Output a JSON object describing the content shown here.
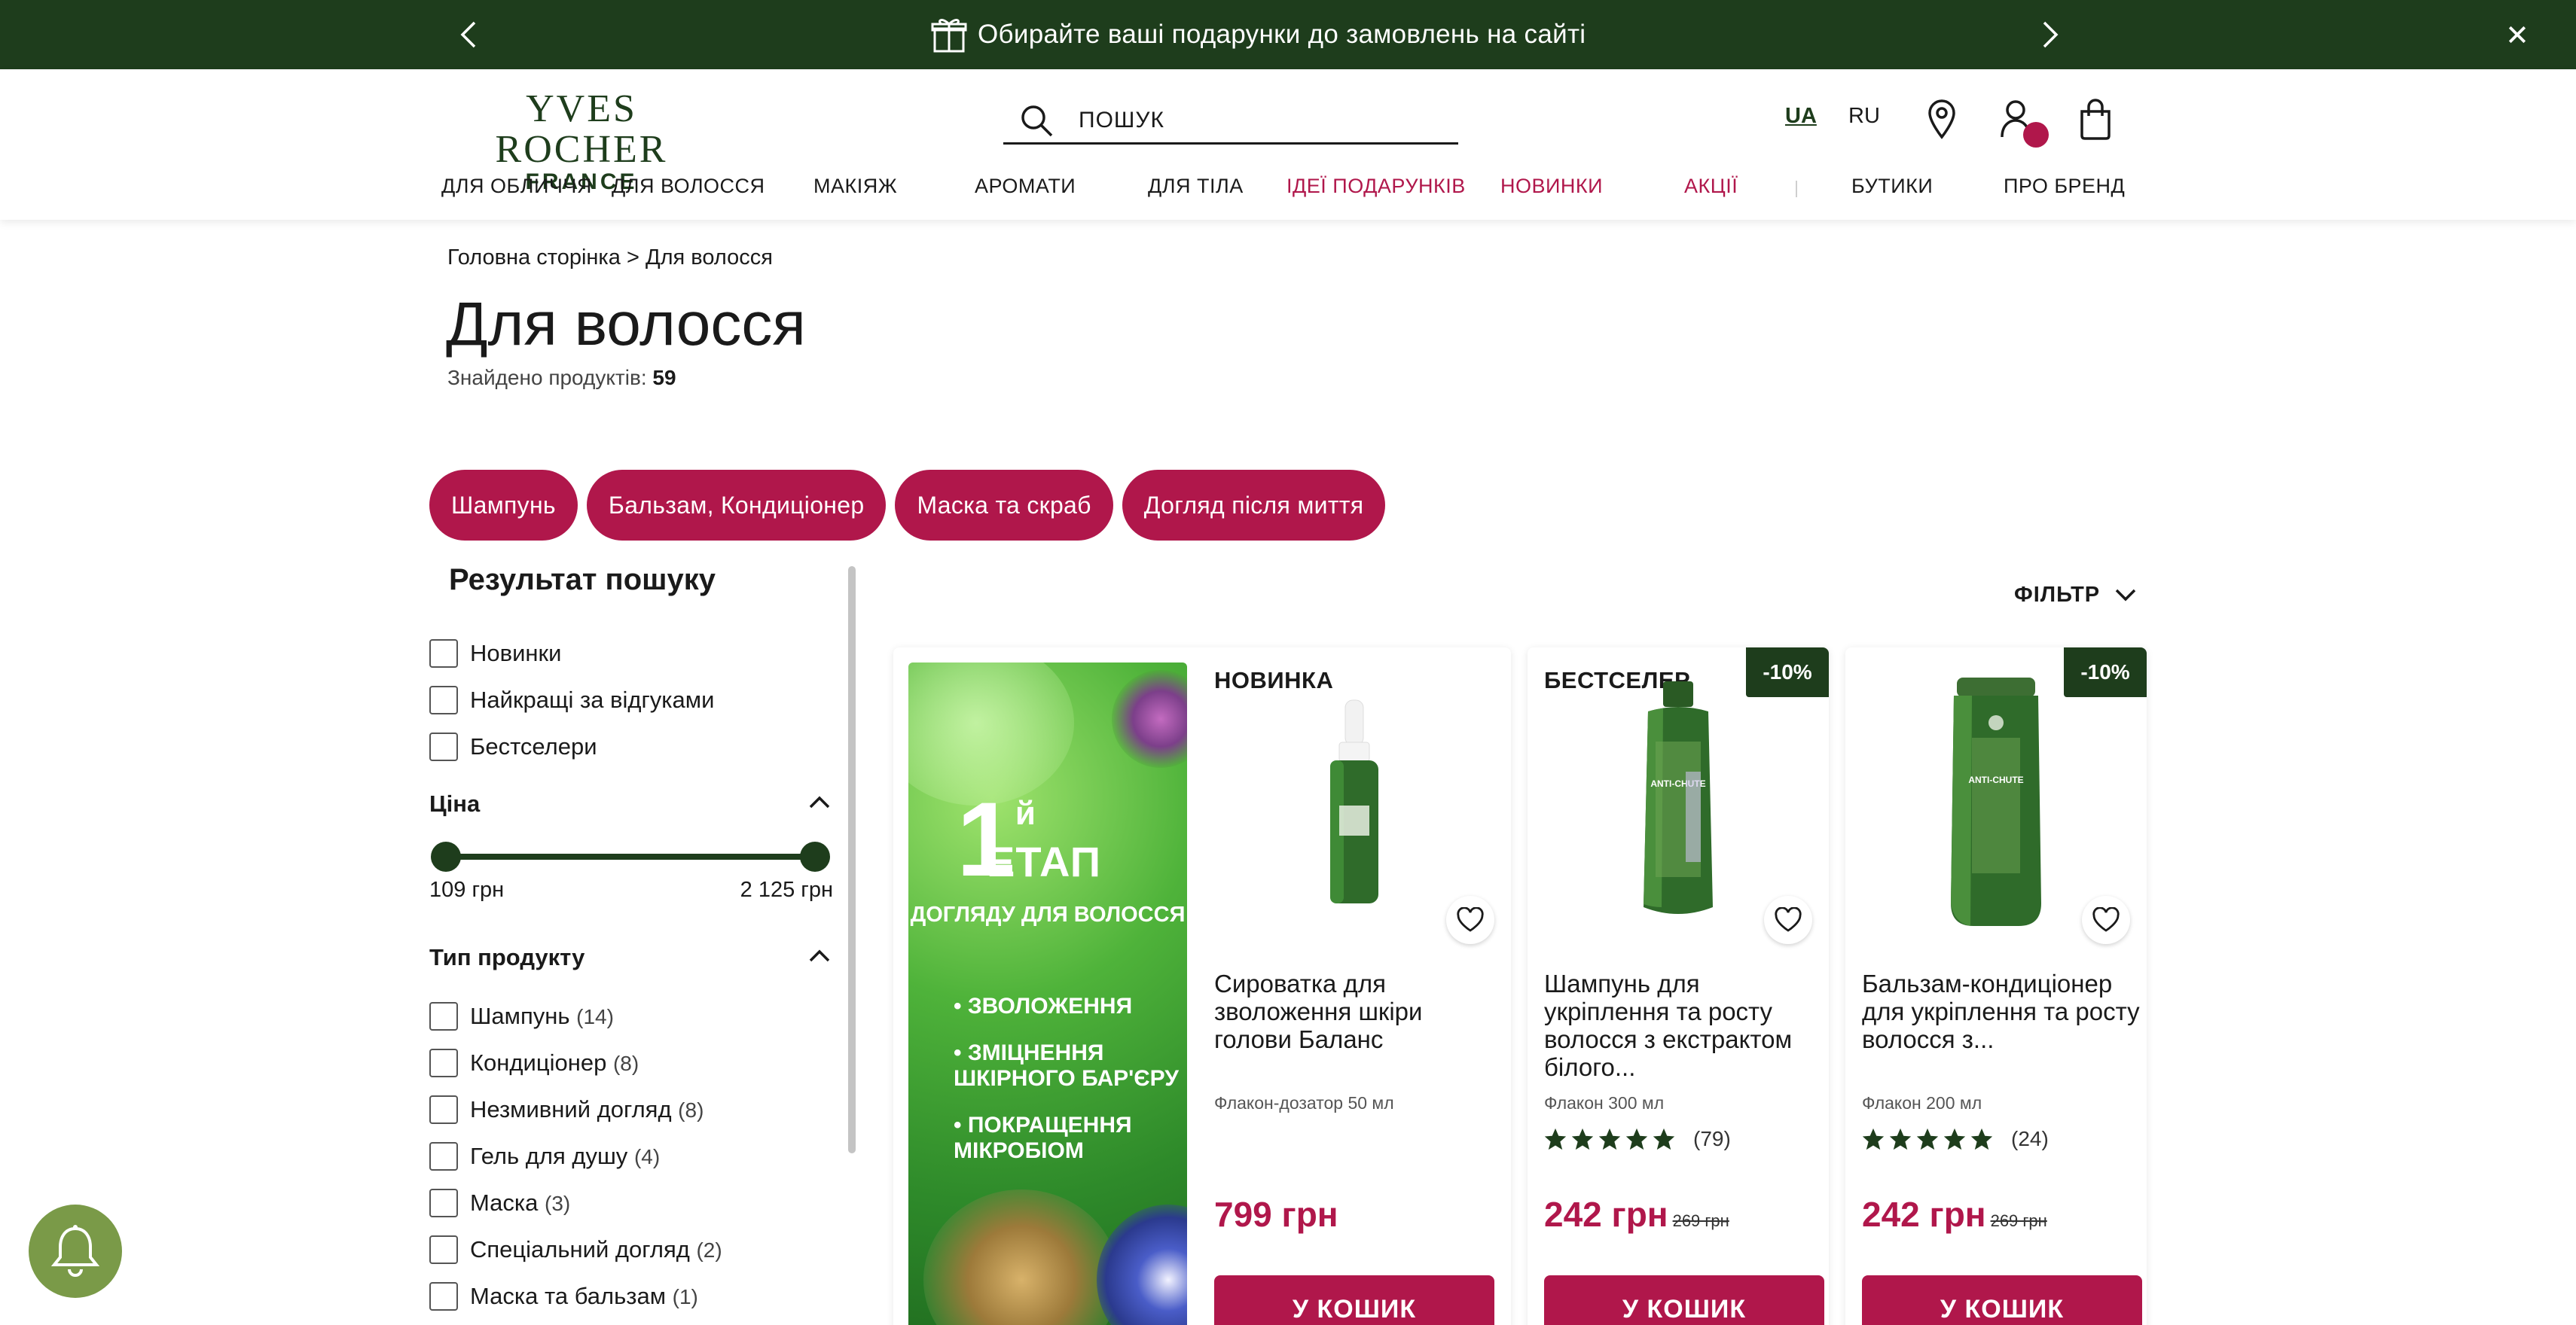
{
  "promo": {
    "message": "Обирайте ваші подарунки до замовлень на сайті"
  },
  "header": {
    "logo_line1": "YVES ROCHER",
    "logo_line2": "FRANCE",
    "search_placeholder": "ПОШУК",
    "lang_ua": "UA",
    "lang_ru": "RU"
  },
  "nav": [
    "ДЛЯ ОБЛИЧЧЯ",
    "ДЛЯ ВОЛОССЯ",
    "МАКІЯЖ",
    "АРОМАТИ",
    "ДЛЯ ТІЛА",
    "ІДЕЇ ПОДАРУНКІВ",
    "НОВИНКИ",
    "АКЦІЇ",
    "БУТИКИ",
    "ПРО БРЕНД"
  ],
  "breadcrumb": {
    "home": "Головна сторінка",
    "sep": ">",
    "current": "Для волосся"
  },
  "page": {
    "title": "Для волосся",
    "found_label": "Знайдено продуктів:",
    "found_count": "59"
  },
  "chips": [
    "Шампунь",
    "Бальзам, Кондиціонер",
    "Маска та скраб",
    "Догляд після миття"
  ],
  "sidebar": {
    "title": "Результат пошуку",
    "quick": [
      "Новинки",
      "Найкращі за відгуками",
      "Бестселери"
    ],
    "price_title": "Ціна",
    "price_min": "109 грн",
    "price_max": "2 125 грн",
    "type_title": "Тип продукту",
    "types": [
      {
        "label": "Шампунь",
        "count": "(14)"
      },
      {
        "label": "Кондиціонер",
        "count": "(8)"
      },
      {
        "label": "Незмивний догляд",
        "count": "(8)"
      },
      {
        "label": "Гель для душу",
        "count": "(4)"
      },
      {
        "label": "Маска",
        "count": "(3)"
      },
      {
        "label": "Спеціальний догляд",
        "count": "(2)"
      },
      {
        "label": "Маска та бальзам",
        "count": "(1)"
      }
    ]
  },
  "filter_label": "ФІЛЬТР",
  "banner": {
    "num": "1",
    "sup": "й",
    "word": "ЕТАП",
    "sub": "ДОГЛЯДУ ДЛЯ ВОЛОССЯ",
    "bullets": [
      "• ЗВОЛОЖЕННЯ",
      "• ЗМІЦНЕННЯ ШКІРНОГО БАР'ЄРУ",
      "• ПОКРАЩЕННЯ МІКРОБІОМ"
    ]
  },
  "products": [
    {
      "tag": "НОВИНКА",
      "name": "Сироватка для зволоження шкіри голови Баланс",
      "volume": "Флакон-дозатор 50 мл",
      "price": "799 грн",
      "cart": "У КОШИК"
    },
    {
      "tag": "БЕСТСЕЛЕР",
      "discount": "-10%",
      "name": "Шампунь для укріплення та росту волосся з екстрактом білого...",
      "volume": "Флакон 300 мл",
      "rating": 5,
      "reviews": "(79)",
      "price": "242 грн",
      "old_price": "269 грн",
      "cart": "У КОШИК"
    },
    {
      "discount": "-10%",
      "name": "Бальзам-кондиціонер для укріплення та росту волосся з...",
      "volume": "Флакон 200 мл",
      "rating": 5,
      "reviews": "(24)",
      "price": "242 грн",
      "old_price": "269 грн",
      "cart": "У КОШИК"
    }
  ],
  "colors": {
    "brand_green": "#1e3d1c",
    "accent_pink": "#b0174b",
    "bell_green": "#7a9a48"
  }
}
